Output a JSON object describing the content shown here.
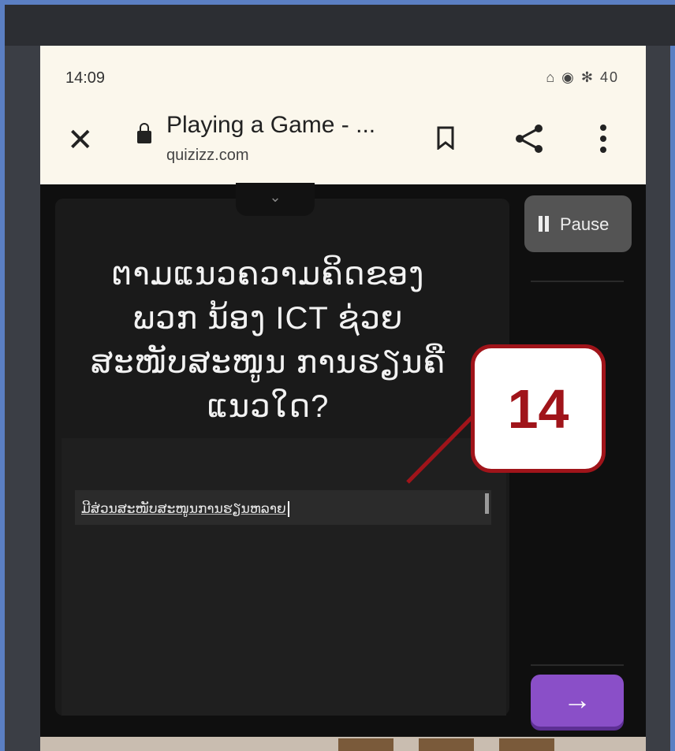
{
  "status_bar": {
    "time": "14:09",
    "right_icons": "⌂ ◉ ✻ 40"
  },
  "browser": {
    "title": "Playing a Game - ...",
    "domain": "quizizz.com"
  },
  "quiz": {
    "question": "ຕາມແນວຄວາມຄິດຂອງພວກ ນ້ອງ ICT ຊ່ວຍສະໜັບສະໜູນ ການຮຽນຄືແນວໃດ?",
    "answer_value": "ມີສ່ວນສະໜັບສະໜູນການຮຽນຫລາຍ",
    "pause_label": "Pause",
    "next_icon": "→"
  },
  "annotation": {
    "label": "14",
    "color": "#a0141a"
  },
  "colors": {
    "browser_bar": "#fbf7ec",
    "next_button": "#8a4fc8",
    "frame_border": "#5b7fc3"
  }
}
